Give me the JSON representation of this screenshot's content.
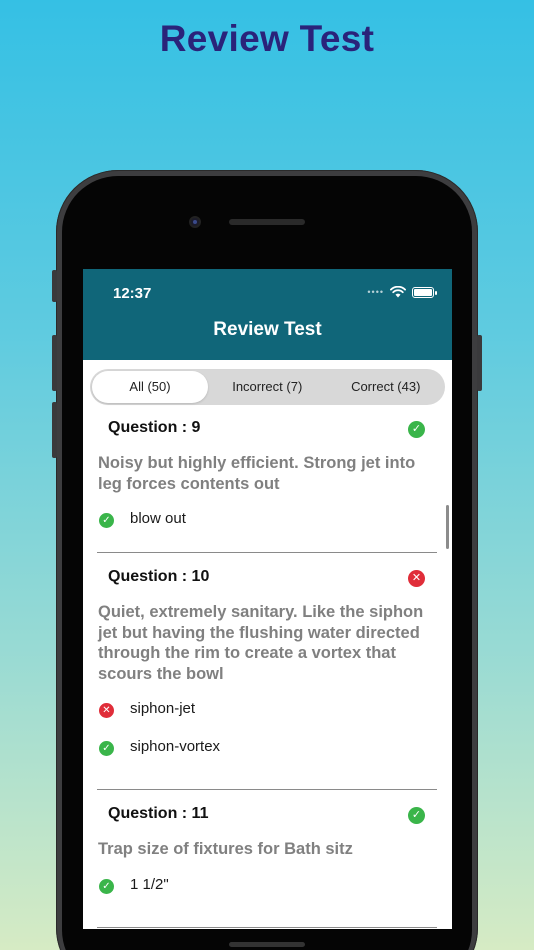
{
  "promo": {
    "title": "Review Test"
  },
  "status_bar": {
    "time": "12:37"
  },
  "header": {
    "title": "Review Test"
  },
  "segments": [
    {
      "label": "All (50)",
      "active": true
    },
    {
      "label": "Incorrect (7)",
      "active": false
    },
    {
      "label": "Correct (43)",
      "active": false
    }
  ],
  "questions": [
    {
      "title": "Question : 9",
      "status": "correct",
      "text": "Noisy but highly efficient. Strong jet into leg forces contents out",
      "answers": [
        {
          "text": "blow out",
          "status": "correct"
        }
      ]
    },
    {
      "title": "Question : 10",
      "status": "incorrect",
      "text": "Quiet, extremely sanitary. Like the siphon jet but having the flushing water directed through the rim to create a vortex that scours the bowl",
      "answers": [
        {
          "text": "siphon-jet",
          "status": "incorrect"
        },
        {
          "text": "siphon-vortex",
          "status": "correct"
        }
      ]
    },
    {
      "title": "Question : 11",
      "status": "correct",
      "text": "Trap size of fixtures for Bath sitz",
      "answers": [
        {
          "text": "1 1/2\"",
          "status": "correct"
        }
      ]
    }
  ],
  "icons": {
    "correct": "check-circle-icon",
    "incorrect": "x-circle-icon"
  },
  "colors": {
    "header_bg": "#106679",
    "correct": "#3ab54a",
    "incorrect": "#e02d39",
    "promo_title": "#2a237a"
  }
}
